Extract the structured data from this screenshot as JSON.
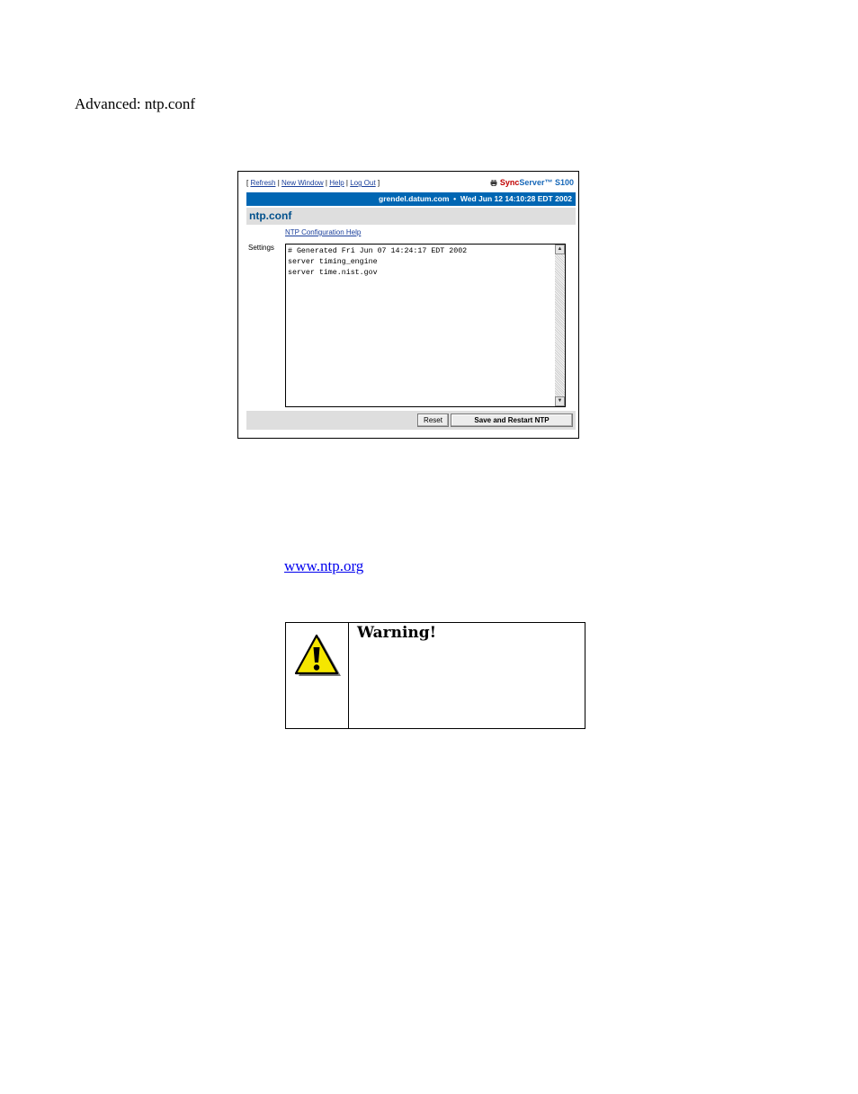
{
  "page": {
    "heading": "Advanced: ntp.conf",
    "link": "www.ntp.org"
  },
  "screenshot": {
    "nav": {
      "refresh": "Refresh",
      "new_window": "New Window",
      "help": "Help",
      "log_out": "Log Out"
    },
    "brand": {
      "sync": "Sync",
      "server": "Server™",
      "model": "S100",
      "sync_color": "#c00000",
      "server_color": "#1667b8"
    },
    "status": {
      "host": "grendel.datum.com",
      "separator": "•",
      "datetime": "Wed Jun 12 14:10:28 EDT 2002",
      "bar_color": "#0066b3"
    },
    "title": "ntp.conf",
    "help_link": "NTP Configuration Help",
    "settings_label": "Settings",
    "settings_value": "# Generated Fri Jun 07 14:24:17 EDT 2002\nserver timing_engine\nserver time.nist.gov",
    "buttons": {
      "reset": "Reset",
      "save": "Save and Restart NTP"
    },
    "icons": [
      "printer-icon",
      "scroll-up-icon",
      "scroll-down-icon"
    ]
  },
  "warning": {
    "title": "Warning!",
    "icon": "warning-triangle-icon",
    "icon_color": "#f5e600"
  }
}
